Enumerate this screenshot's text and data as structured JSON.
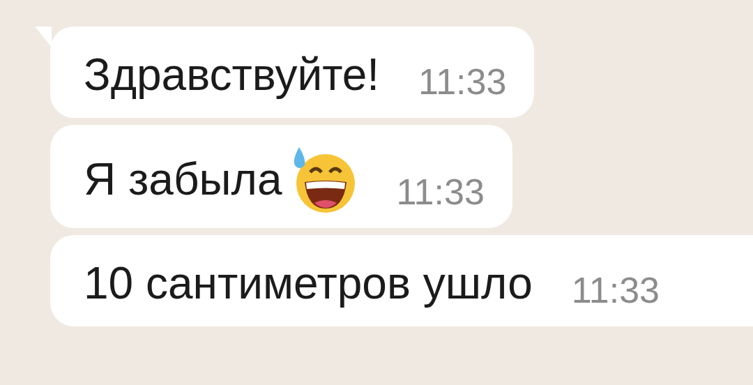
{
  "messages": [
    {
      "text": "Здравствуйте!",
      "time": "11:33",
      "tail": true,
      "has_emoji": false
    },
    {
      "text": "Я забыла",
      "time": "11:33",
      "tail": false,
      "has_emoji": true
    },
    {
      "text": "10 сантиметров ушло",
      "time": "11:33",
      "tail": false,
      "has_emoji": false
    }
  ]
}
